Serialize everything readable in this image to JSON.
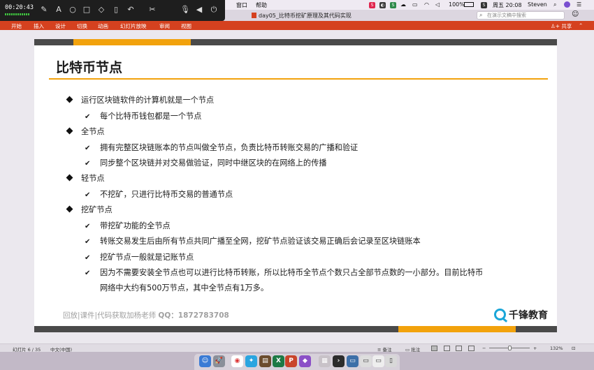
{
  "menubar": {
    "items": [
      "窗口",
      "帮助"
    ],
    "battery": "100%",
    "clock": "周五 20:08",
    "user": "Steven",
    "status_icon_letters": [
      "S",
      "S"
    ],
    "colors": {
      "bg": "#efeaf2"
    }
  },
  "window": {
    "title": "day05_比特币挖矿原理及其代码实现",
    "search_placeholder": "在演示文稿中搜索"
  },
  "ribbon": {
    "tabs": [
      "开始",
      "插入",
      "设计",
      "切换",
      "动画",
      "幻灯片放映",
      "审阅",
      "视图"
    ],
    "share": "共享",
    "color": "#d5411f"
  },
  "recorder": {
    "elapsed": "00:20:43",
    "tools": [
      "pen-icon",
      "text-icon",
      "circle-icon",
      "rectangle-icon",
      "eraser-icon",
      "trash-icon",
      "undo-icon",
      "scissors-icon",
      "microphone-icon",
      "speaker-icon",
      "power-icon"
    ]
  },
  "slide": {
    "title": "比特币节点",
    "accent": "#f2a20c",
    "bullets": [
      {
        "text": "运行区块链软件的计算机就是一个节点",
        "subs": [
          "每个比特币钱包都是一个节点"
        ]
      },
      {
        "text": "全节点",
        "subs": [
          "拥有完整区块链账本的节点叫做全节点，负责比特币转账交易的广播和验证",
          "同步整个区块链并对交易做验证，同时中继区块的在网络上的传播"
        ]
      },
      {
        "text": "轻节点",
        "subs": [
          "不挖矿，只进行比特币交易的普通节点"
        ]
      },
      {
        "text": "挖矿节点",
        "subs": [
          "带挖矿功能的全节点",
          "转账交易发生后由所有节点共同广播至全网，挖矿节点验证该交易正确后会记录至区块链账本",
          "挖矿节点一般就是记账节点",
          "因为不需要安装全节点也可以进行比特币转账，所以比特币全节点个数只占全部节点数的一小部分。目前比特币",
          "网络中大约有500万节点，其中全节点有1万多。"
        ]
      }
    ],
    "footer": {
      "text": "回放|课件|代码获取加杨老师",
      "qq": "QQ：1872783708"
    },
    "logo": "千锋教育"
  },
  "statusbar": {
    "slide_indicator": "幻灯片 6 / 35",
    "language": "中文(中国)",
    "notes": "备注",
    "comments": "批注",
    "zoom": "132%"
  }
}
